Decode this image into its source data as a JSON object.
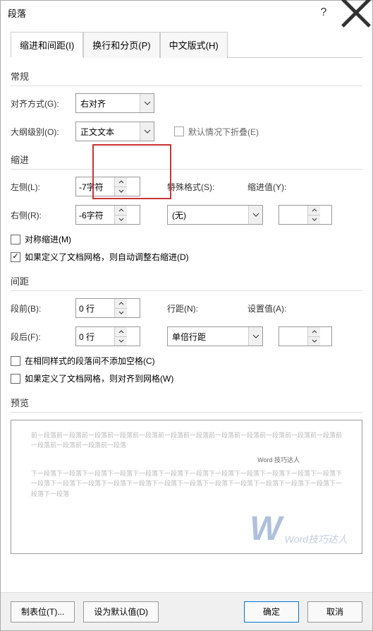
{
  "title": "段落",
  "tabs": {
    "indent": "缩进和间距(I)",
    "pagination": "换行和分页(P)",
    "chinese": "中文版式(H)"
  },
  "general": {
    "title": "常规",
    "align_label": "对齐方式(G):",
    "align_value": "右对齐",
    "outline_label": "大纲级别(O):",
    "outline_value": "正文文本",
    "collapse_label": "默认情况下折叠(E)"
  },
  "indent": {
    "title": "缩进",
    "left_label": "左侧(L):",
    "left_value": "-7字符",
    "right_label": "右侧(R):",
    "right_value": "-6字符",
    "special_label": "特殊格式(S):",
    "special_value": "(无)",
    "indent_by_label": "缩进值(Y):",
    "indent_by_value": "",
    "sym_label": "对称缩进(M)",
    "grid_label": "如果定义了文档网格，则自动调整右缩进(D)"
  },
  "spacing": {
    "title": "间距",
    "before_label": "段前(B):",
    "before_value": "0 行",
    "after_label": "段后(F):",
    "after_value": "0 行",
    "line_label": "行距(N):",
    "line_value": "单倍行距",
    "at_label": "设置值(A):",
    "at_value": "",
    "no_space_label": "在相同样式的段落间不添加空格(C)",
    "grid_label": "如果定义了文档网格，则对齐到网格(W)"
  },
  "preview": {
    "title": "预览",
    "before_text": "前一段落前一段落前一段落前一段落前一段落前一段落前一段落前一段落前一段落前一段落前一段落前一段落前一段落前一段落前一段落前一段落",
    "mid_text": "Word 技巧达人",
    "after_text": "下一段落下一段落下一段落下一段落下一段落下一段落下一段落下一段落下一段落下一段落下一段落下一段落下一段落下一段落下一段落下一段落下一段落下一段落下一段落下一段落下一段落下一段落下一段落下一段落下一段落下一段落",
    "watermark": "Word技巧达人"
  },
  "footer": {
    "tabs": "制表位(T)...",
    "default": "设为默认值(D)",
    "ok": "确定",
    "cancel": "取消"
  }
}
